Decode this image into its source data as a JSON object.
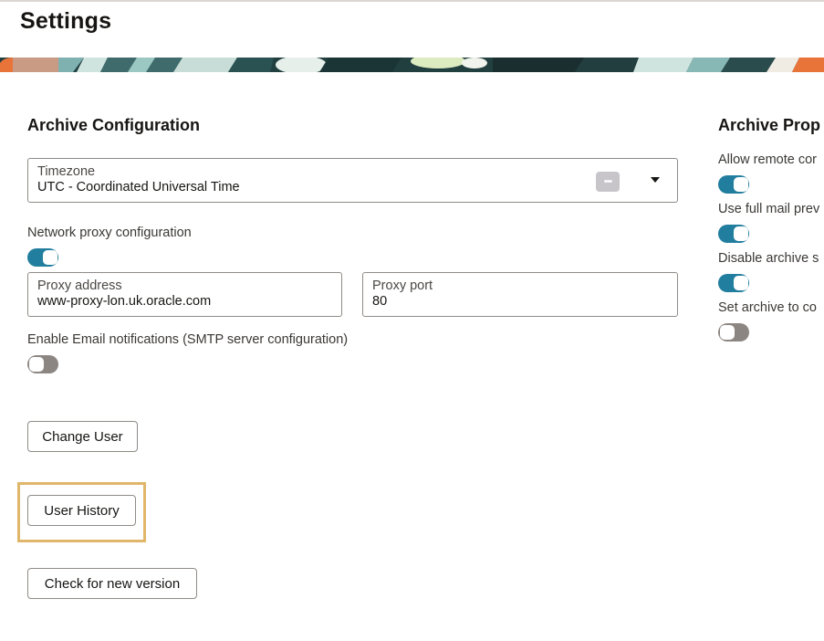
{
  "page": {
    "title": "Settings"
  },
  "archive_configuration": {
    "title": "Archive Configuration",
    "timezone": {
      "label": "Timezone",
      "value": "UTC - Coordinated Universal Time",
      "more_glyph": "•••"
    },
    "network_proxy": {
      "label": "Network proxy configuration",
      "enabled": true,
      "address": {
        "label": "Proxy address",
        "value": "www-proxy-lon.uk.oracle.com"
      },
      "port": {
        "label": "Proxy port",
        "value": "80"
      }
    },
    "email_notifications": {
      "label": "Enable Email notifications (SMTP server configuration)",
      "enabled": false
    },
    "buttons": {
      "change_user": "Change User",
      "user_history": "User History",
      "check_version": "Check for new version"
    }
  },
  "archive_properties": {
    "title": "Archive Prop",
    "items": [
      {
        "label": "Allow remote cor",
        "enabled": true
      },
      {
        "label": "Use full mail prev",
        "enabled": true
      },
      {
        "label": "Disable archive s",
        "enabled": true
      },
      {
        "label": "Set archive to co",
        "enabled": false
      }
    ]
  },
  "colors": {
    "toggle_on": "#227e9e",
    "toggle_off": "#8c8682",
    "highlight": "#e0b66a"
  }
}
